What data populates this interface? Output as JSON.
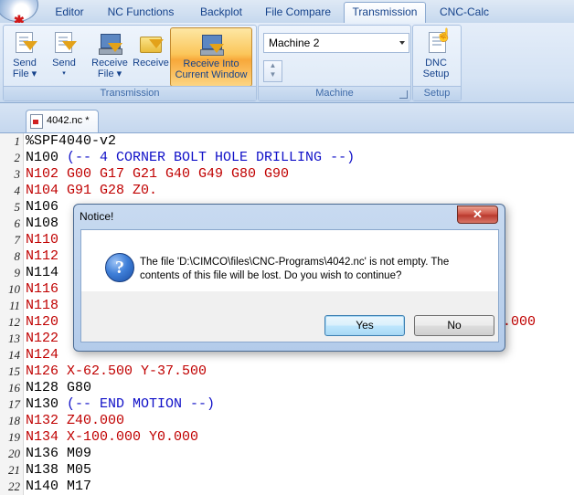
{
  "tabs": [
    "Editor",
    "NC Functions",
    "Backplot",
    "File Compare",
    "Transmission",
    "CNC-Calc"
  ],
  "active_tab": "Transmission",
  "ribbon": {
    "transmission_group": {
      "label": "Transmission",
      "send_file": [
        "Send",
        "File ▾"
      ],
      "send": [
        "Send",
        "▾"
      ],
      "receive_file": [
        "Receive",
        "File ▾"
      ],
      "receive": "Receive",
      "receive_into": [
        "Receive Into",
        "Current Window"
      ]
    },
    "machine_group": {
      "label": "Machine",
      "machine_value": "Machine 2"
    },
    "setup_group": {
      "label": "Setup",
      "dnc_setup": [
        "DNC",
        "Setup"
      ]
    }
  },
  "document_tab": "4042.nc *",
  "editor_lines": [
    {
      "n": "1",
      "text": "%SPF4040-v2",
      "color": "#000000"
    },
    {
      "n": "2",
      "text": "N100 (-- 4 CORNER BOLT HOLE DRILLING --)",
      "color": "#1010c8",
      "prefix": "N100 "
    },
    {
      "n": "3",
      "text": "N102 G00 G17 G21 G40 G49 G80 G90",
      "color": "#c00000"
    },
    {
      "n": "4",
      "text": "N104 G91 G28 Z0.",
      "color": "#c00000"
    },
    {
      "n": "5",
      "text": "N106",
      "color": "#000000"
    },
    {
      "n": "6",
      "text": "N108",
      "color": "#000000"
    },
    {
      "n": "7",
      "text": "N110",
      "color": "#c00000"
    },
    {
      "n": "8",
      "text": "N112",
      "color": "#c00000"
    },
    {
      "n": "9",
      "text": "N114",
      "color": "#000000"
    },
    {
      "n": "10",
      "text": "N116",
      "color": "#c00000"
    },
    {
      "n": "11",
      "text": "N118",
      "color": "#c00000"
    },
    {
      "n": "12",
      "text": "N120",
      "color": "#c00000",
      "tail": ".000"
    },
    {
      "n": "13",
      "text": "N122",
      "color": "#c00000"
    },
    {
      "n": "14",
      "text": "N124",
      "color": "#c00000"
    },
    {
      "n": "15",
      "text": "N126 X-62.500 Y-37.500",
      "color": "#c00000"
    },
    {
      "n": "16",
      "text": "N128 G80",
      "color": "#000000"
    },
    {
      "n": "17",
      "text": "N130 (-- END MOTION --)",
      "color": "#1010c8",
      "prefix": "N130 "
    },
    {
      "n": "18",
      "text": "N132 Z40.000",
      "color": "#c00000"
    },
    {
      "n": "19",
      "text": "N134 X-100.000 Y0.000",
      "color": "#c00000"
    },
    {
      "n": "20",
      "text": "N136 M09",
      "color": "#000000"
    },
    {
      "n": "21",
      "text": "N138 M05",
      "color": "#000000"
    },
    {
      "n": "22",
      "text": "N140 M17",
      "color": "#000000"
    }
  ],
  "dialog": {
    "title": "Notice!",
    "close": "✕",
    "message": "The file 'D:\\CIMCO\\files\\CNC-Programs\\4042.nc' is not empty. The contents of this file will be lost. Do you wish to continue?",
    "yes": "Yes",
    "no": "No"
  }
}
